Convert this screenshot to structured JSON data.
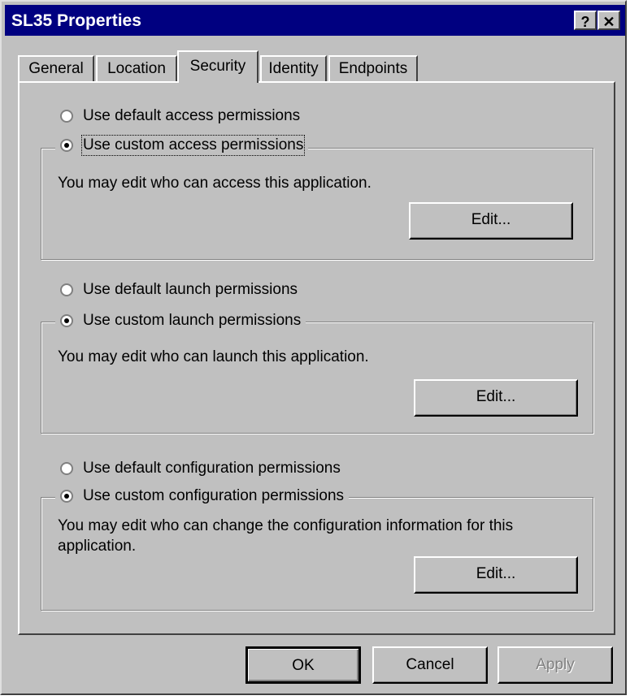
{
  "window": {
    "title": "SL35 Properties",
    "help_label": "?",
    "close_label": "✕"
  },
  "tabs": [
    {
      "label": "General"
    },
    {
      "label": "Location"
    },
    {
      "label": "Security",
      "active": true
    },
    {
      "label": "Identity"
    },
    {
      "label": "Endpoints"
    }
  ],
  "access": {
    "default_label": "Use default access permissions",
    "custom_label": "Use custom access permissions",
    "selected": "custom",
    "description": "You may edit who can access this application.",
    "edit_label": "Edit..."
  },
  "launch": {
    "default_label": "Use default launch permissions",
    "custom_label": "Use custom launch permissions",
    "selected": "custom",
    "description": "You may edit who can launch this application.",
    "edit_label": "Edit..."
  },
  "configuration": {
    "default_label": "Use default configuration permissions",
    "custom_label": "Use custom configuration permissions",
    "selected": "custom",
    "description": "You may edit who can change the configuration information for this application.",
    "edit_label": "Edit..."
  },
  "footer": {
    "ok_label": "OK",
    "cancel_label": "Cancel",
    "apply_label": "Apply",
    "apply_enabled": false
  }
}
